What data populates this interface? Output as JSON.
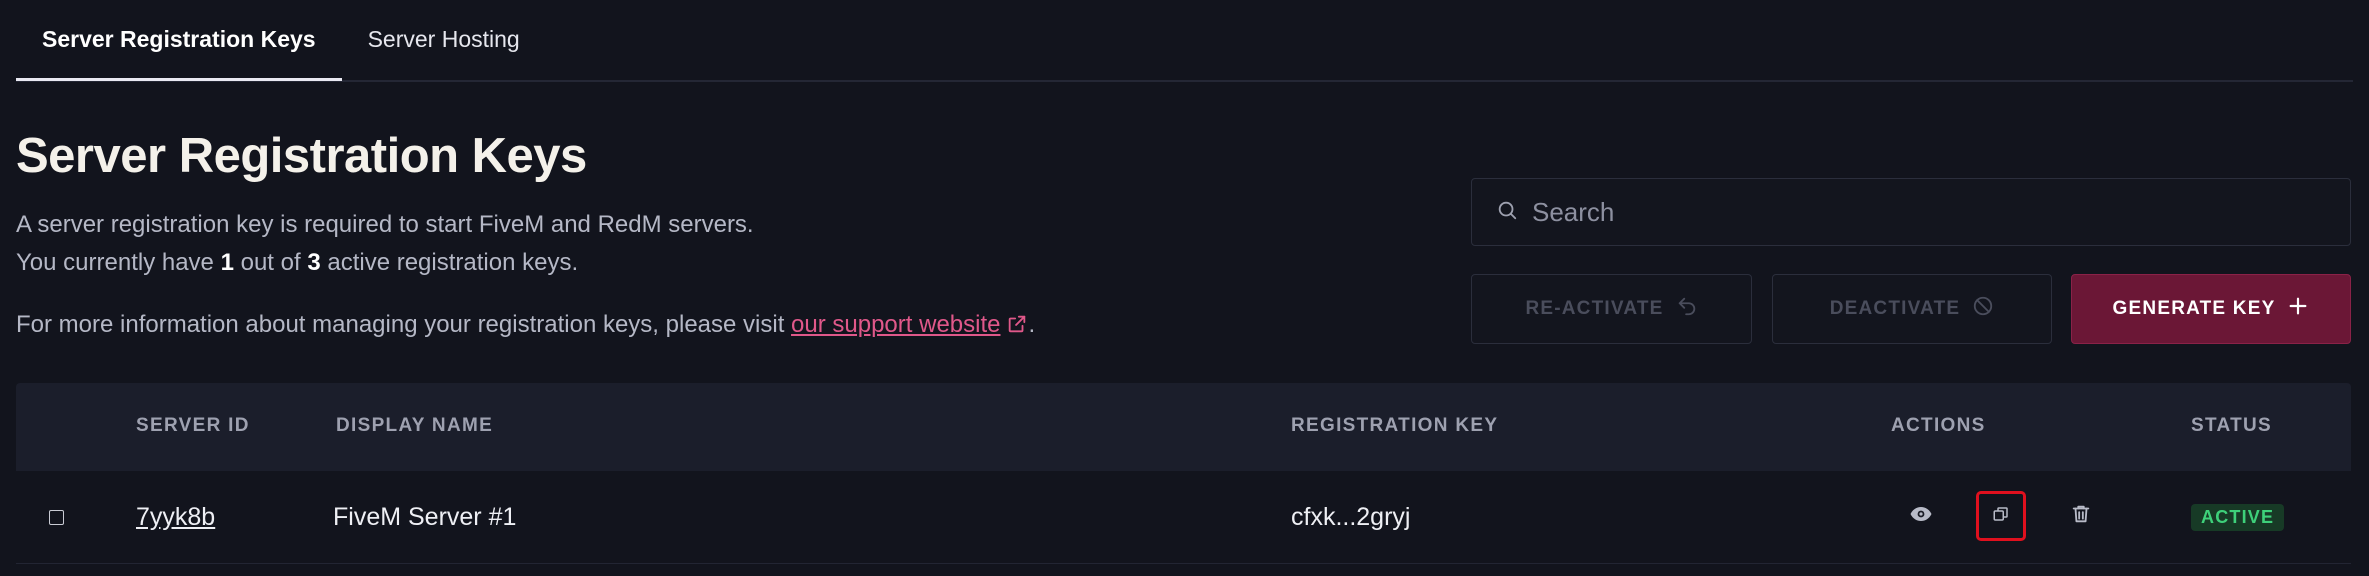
{
  "tabs": [
    {
      "label": "Server Registration Keys",
      "active": true
    },
    {
      "label": "Server Hosting",
      "active": false
    }
  ],
  "page": {
    "title": "Server Registration Keys",
    "line1": "A server registration key is required to start FiveM and RedM servers.",
    "line2_pre": "You currently have ",
    "active_count": "1",
    "line2_mid": " out of ",
    "max_count": "3",
    "line2_post": " active registration keys.",
    "info_pre": "For more information about managing your registration keys, please visit ",
    "support_link": "our support website",
    "info_post": "."
  },
  "search": {
    "placeholder": "Search",
    "value": ""
  },
  "buttons": {
    "reactivate": "RE-ACTIVATE",
    "deactivate": "DEACTIVATE",
    "generate": "GENERATE KEY"
  },
  "table": {
    "headers": {
      "server_id": "SERVER ID",
      "display_name": "DISPLAY NAME",
      "registration_key": "REGISTRATION KEY",
      "actions": "ACTIONS",
      "status": "STATUS"
    },
    "rows": [
      {
        "server_id": "7yyk8b",
        "display_name": "FiveM Server #1",
        "registration_key": "cfxk...2gryj",
        "status": "ACTIVE",
        "actions": [
          "eye-icon",
          "copy-icon",
          "trash-icon"
        ]
      }
    ]
  },
  "colors": {
    "background": "#12141d",
    "accent": "#6b1736",
    "link": "#e0588a",
    "status_active": "#3ed07a",
    "highlight": "#e0101e"
  }
}
